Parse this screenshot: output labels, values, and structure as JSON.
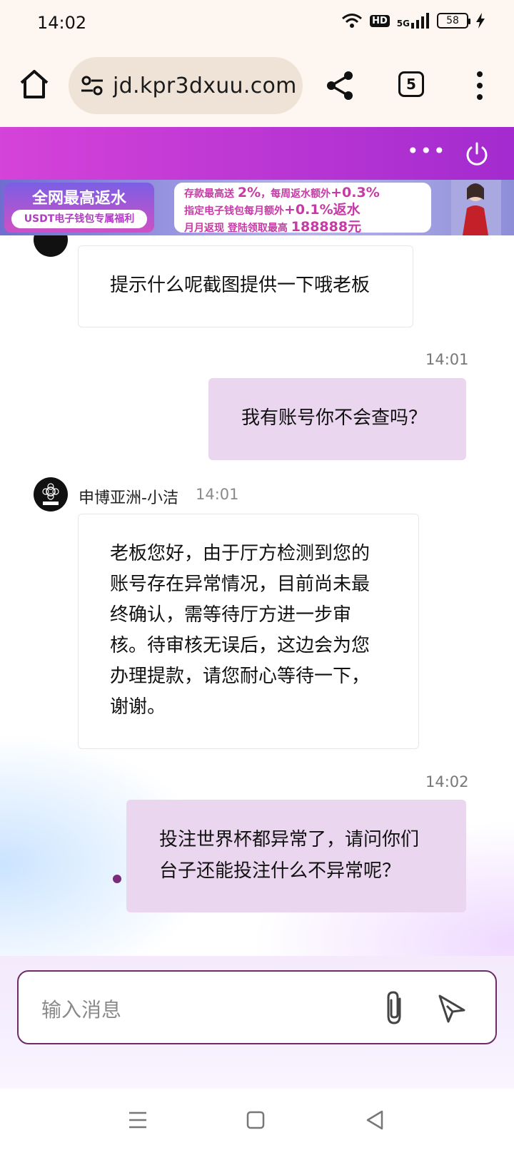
{
  "status_bar": {
    "time": "14:02",
    "hd": "HD",
    "network": "5G",
    "battery": "58"
  },
  "browser": {
    "url": "jd.kpr3dxuu.com",
    "tab_count": "5"
  },
  "banner": {
    "left_title": "全网最高返水",
    "left_sub": "USDT电子钱包专属福利",
    "line1_a": "存款最高送",
    "line1_b": "2%",
    "line1_c": "，每周返水额外",
    "line1_d": "+0.3%",
    "line2_a": "指定电子钱包每月额外",
    "line2_b": "+0.1%返水",
    "line3_a": "月月返现 登陆领取最高",
    "line3_b": "188888元"
  },
  "chat": {
    "messages": [
      {
        "text": "提示什么呢截图提供一下哦老板"
      },
      {
        "time": "14:01",
        "text": "我有账号你不会查吗？"
      },
      {
        "sender": "申博亚洲-小洁",
        "time": "14:01",
        "lines": [
          "老板您好，由于厅方检测到您的",
          "账号存在异常情况，目前尚未最",
          "终确认，需等待厅方进一步审",
          "核。待审核无误后，这边会为您",
          "办理提款，请您耐心等待一下，",
          "谢谢。"
        ]
      },
      {
        "time": "14:02",
        "lines": [
          "投注世界杯都异常了，请问你们",
          "台子还能投注什么不异常呢？"
        ]
      }
    ]
  },
  "input": {
    "placeholder": "输入消息"
  },
  "colors": {
    "header_gradient_start": "#d543d9",
    "header_gradient_end": "#a32bcf",
    "outgoing_bubble": "#ead6ee",
    "input_border": "#6c2c6a"
  }
}
